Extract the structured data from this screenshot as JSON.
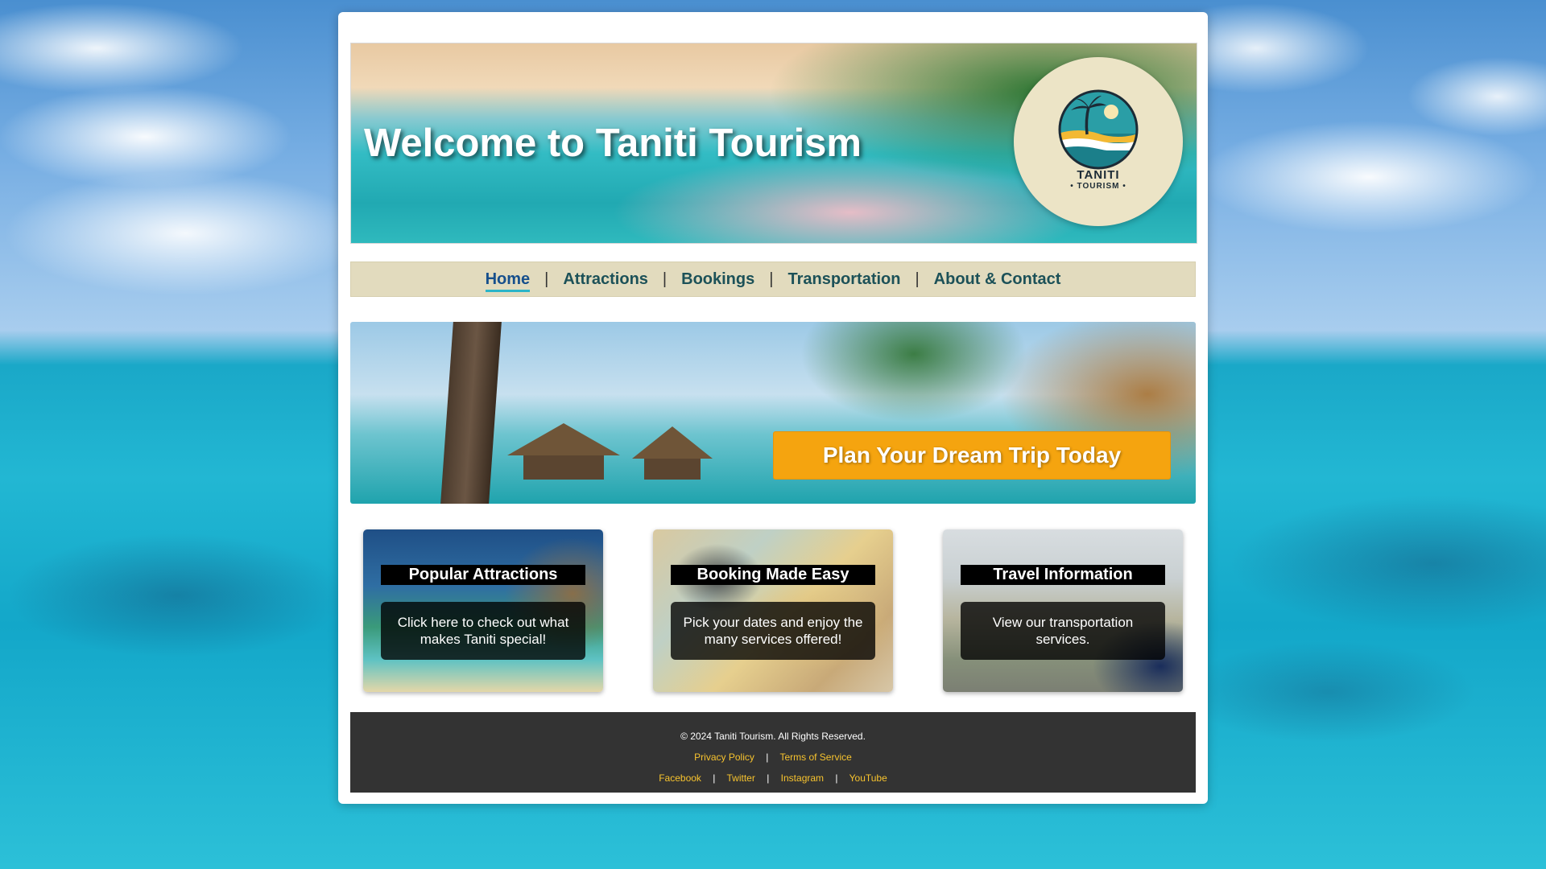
{
  "header": {
    "title": "Welcome to Taniti Tourism",
    "logo": {
      "line1": "TANITI",
      "line2": "• TOURISM •"
    }
  },
  "nav": {
    "items": [
      {
        "label": "Home",
        "active": true
      },
      {
        "label": "Attractions",
        "active": false
      },
      {
        "label": "Bookings",
        "active": false
      },
      {
        "label": "Transportation",
        "active": false
      },
      {
        "label": "About & Contact",
        "active": false
      }
    ],
    "separator": "|"
  },
  "banner": {
    "cta_label": "Plan Your Dream Trip Today"
  },
  "cards": [
    {
      "title": "Popular Attractions",
      "description": "Click here to check out what makes Taniti special!"
    },
    {
      "title": "Booking Made Easy",
      "description": "Pick your dates and enjoy the many services offered!"
    },
    {
      "title": "Travel Information",
      "description": "View our transportation services."
    }
  ],
  "footer": {
    "copyright": "© 2024 Taniti Tourism. All Rights Reserved.",
    "legal_links": [
      "Privacy Policy",
      "Terms of Service"
    ],
    "social_links": [
      "Facebook",
      "Twitter",
      "Instagram",
      "YouTube"
    ],
    "separator": "|"
  },
  "colors": {
    "accent": "#f5a40f",
    "nav_background": "#e2dbbe",
    "nav_text": "#1c5158",
    "footer_background": "#333333",
    "footer_link": "#f7c32e"
  },
  "icons": {
    "logo": "island-sun-palm-icon"
  }
}
